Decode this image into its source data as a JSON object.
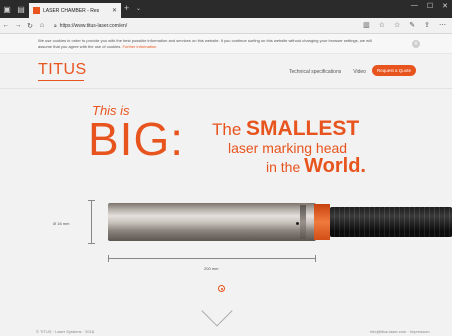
{
  "browser": {
    "tab_title": "LASER CHAMBER - Res",
    "new_tab": "+",
    "url": "https://www.titus-laser.com/en/",
    "window_buttons": [
      "—",
      "☐",
      "✕"
    ]
  },
  "cookie": {
    "text": "We use cookies in order to provide you with the best possible information and services on this website. If you continue surfing on this website without changing your browser settings, we will assume that you agree with the use of cookies.",
    "more_link": "Further information"
  },
  "site": {
    "logo": "TITUS",
    "nav": [
      "Technical specifications",
      "Video"
    ],
    "cta": "Request a Quote"
  },
  "hero": {
    "this_is": "This is",
    "big": "BIG:",
    "the": "The ",
    "smallest": "SMALLEST",
    "line2": "laser marking head",
    "in_the": "in the ",
    "world": "World."
  },
  "product": {
    "height_label": "Ø 16 mm",
    "length_label": "200 mm"
  },
  "footer": {
    "left": "© TITUS · Laser Systems · 2018",
    "right": "info@titus-laser.com · Impressum"
  },
  "colors": {
    "accent": "#e8541e"
  }
}
